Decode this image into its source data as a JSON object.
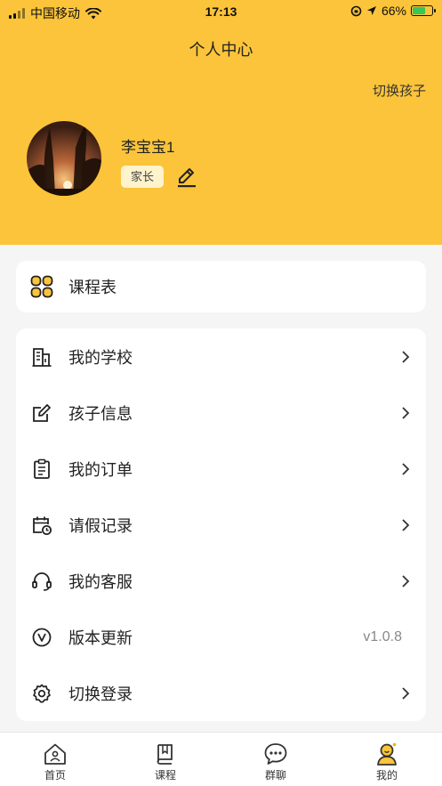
{
  "status_bar": {
    "carrier": "中国移动",
    "time": "17:13",
    "battery": "66%",
    "battery_level": 0.66
  },
  "header": {
    "title": "个人中心",
    "switch_child": "切换孩子"
  },
  "profile": {
    "name": "李宝宝1",
    "role": "家长"
  },
  "schedule": {
    "label": "课程表"
  },
  "menu": {
    "items": [
      {
        "label": "我的学校",
        "icon": "school-building-icon"
      },
      {
        "label": "孩子信息",
        "icon": "edit-note-icon"
      },
      {
        "label": "我的订单",
        "icon": "clipboard-icon"
      },
      {
        "label": "请假记录",
        "icon": "calendar-clock-icon"
      },
      {
        "label": "我的客服",
        "icon": "headset-icon"
      },
      {
        "label": "版本更新",
        "icon": "version-v-icon",
        "value": "v1.0.8"
      },
      {
        "label": "切换登录",
        "icon": "gear-icon"
      }
    ]
  },
  "tabbar": {
    "tabs": [
      {
        "label": "首页",
        "icon": "home-icon"
      },
      {
        "label": "课程",
        "icon": "book-icon"
      },
      {
        "label": "群聊",
        "icon": "chat-icon"
      },
      {
        "label": "我的",
        "icon": "profile-icon",
        "active": true
      }
    ]
  },
  "colors": {
    "header_bg": "#fbc43a",
    "accent": "#f5b400",
    "page_bg": "#f5f5f5"
  }
}
